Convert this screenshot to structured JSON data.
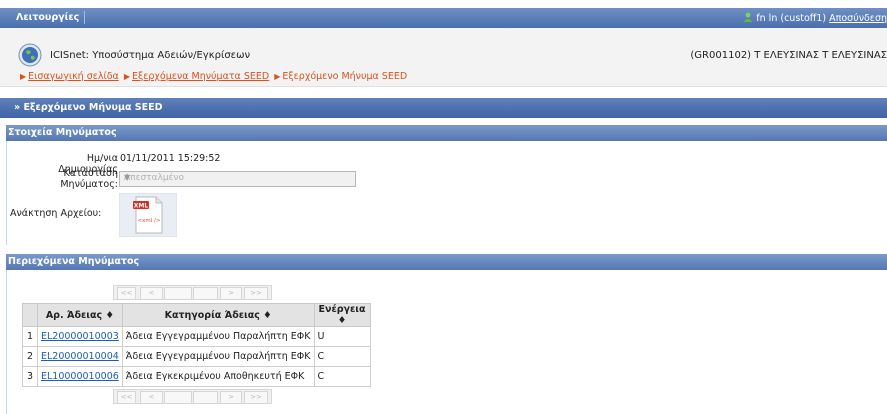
{
  "topbar": {
    "menu_label": "Λειτουργίες",
    "user_text": "fn ln (custoff1)",
    "logout_label": "Αποσύνδεση"
  },
  "header": {
    "app_title": "ICISnet: Υποσύστημα Αδειών/Εγκρίσεων",
    "office": "(GR001102) Τ ΕΛΕΥΣΙΝΑΣ Τ ΕΛΕΥΣΙΝΑΣ",
    "breadcrumbs": [
      "Εισαγωγική σελίδα",
      "Εξερχόμενα Μηνύματα SEED",
      "Εξερχόμενο Μήνυμα SEED"
    ]
  },
  "section_title": "» Εξερχόμενο Μήνυμα SEED",
  "message_panel": {
    "title": "Στοιχεία Μηνύματος",
    "created_label": "Ημ/νια Δημιουργίας",
    "created_value": "01/11/2011 15:29:52",
    "status_label_1": "Κατάσταση",
    "status_label_2": "Μηνύματος:",
    "status_value": "Απεσταλμένο",
    "file_label": "Ανάκτηση Αρχείου:",
    "xml_badge": "XML",
    "xml_tag": "<xml />"
  },
  "contents_panel": {
    "title": "Περιεχόμενα Μηνύματος",
    "pager": {
      "first": "<<",
      "prev": "<",
      "next": ">",
      "last": ">>"
    },
    "columns": [
      "Αρ. Άδειας ♦",
      "Κατηγορία Άδειας ♦",
      "Ενέργεια ♦"
    ],
    "rows": [
      {
        "n": "1",
        "license": "EL20000010003",
        "category": "Άδεια Εγγεγραμμένου Παραλήπτη ΕΦΚ",
        "action": "U"
      },
      {
        "n": "2",
        "license": "EL20000010004",
        "category": "Άδεια Εγγεγραμμένου Παραλήπτη ΕΦΚ",
        "action": "C"
      },
      {
        "n": "3",
        "license": "EL10000010006",
        "category": "Άδεια Εγκεκριμένου Αποθηκευτή ΕΦΚ",
        "action": "C"
      }
    ]
  },
  "colors": {
    "bar_blue": "#4a6fae",
    "link_orange": "#d9531e",
    "link_blue": "#1a5fb4"
  }
}
